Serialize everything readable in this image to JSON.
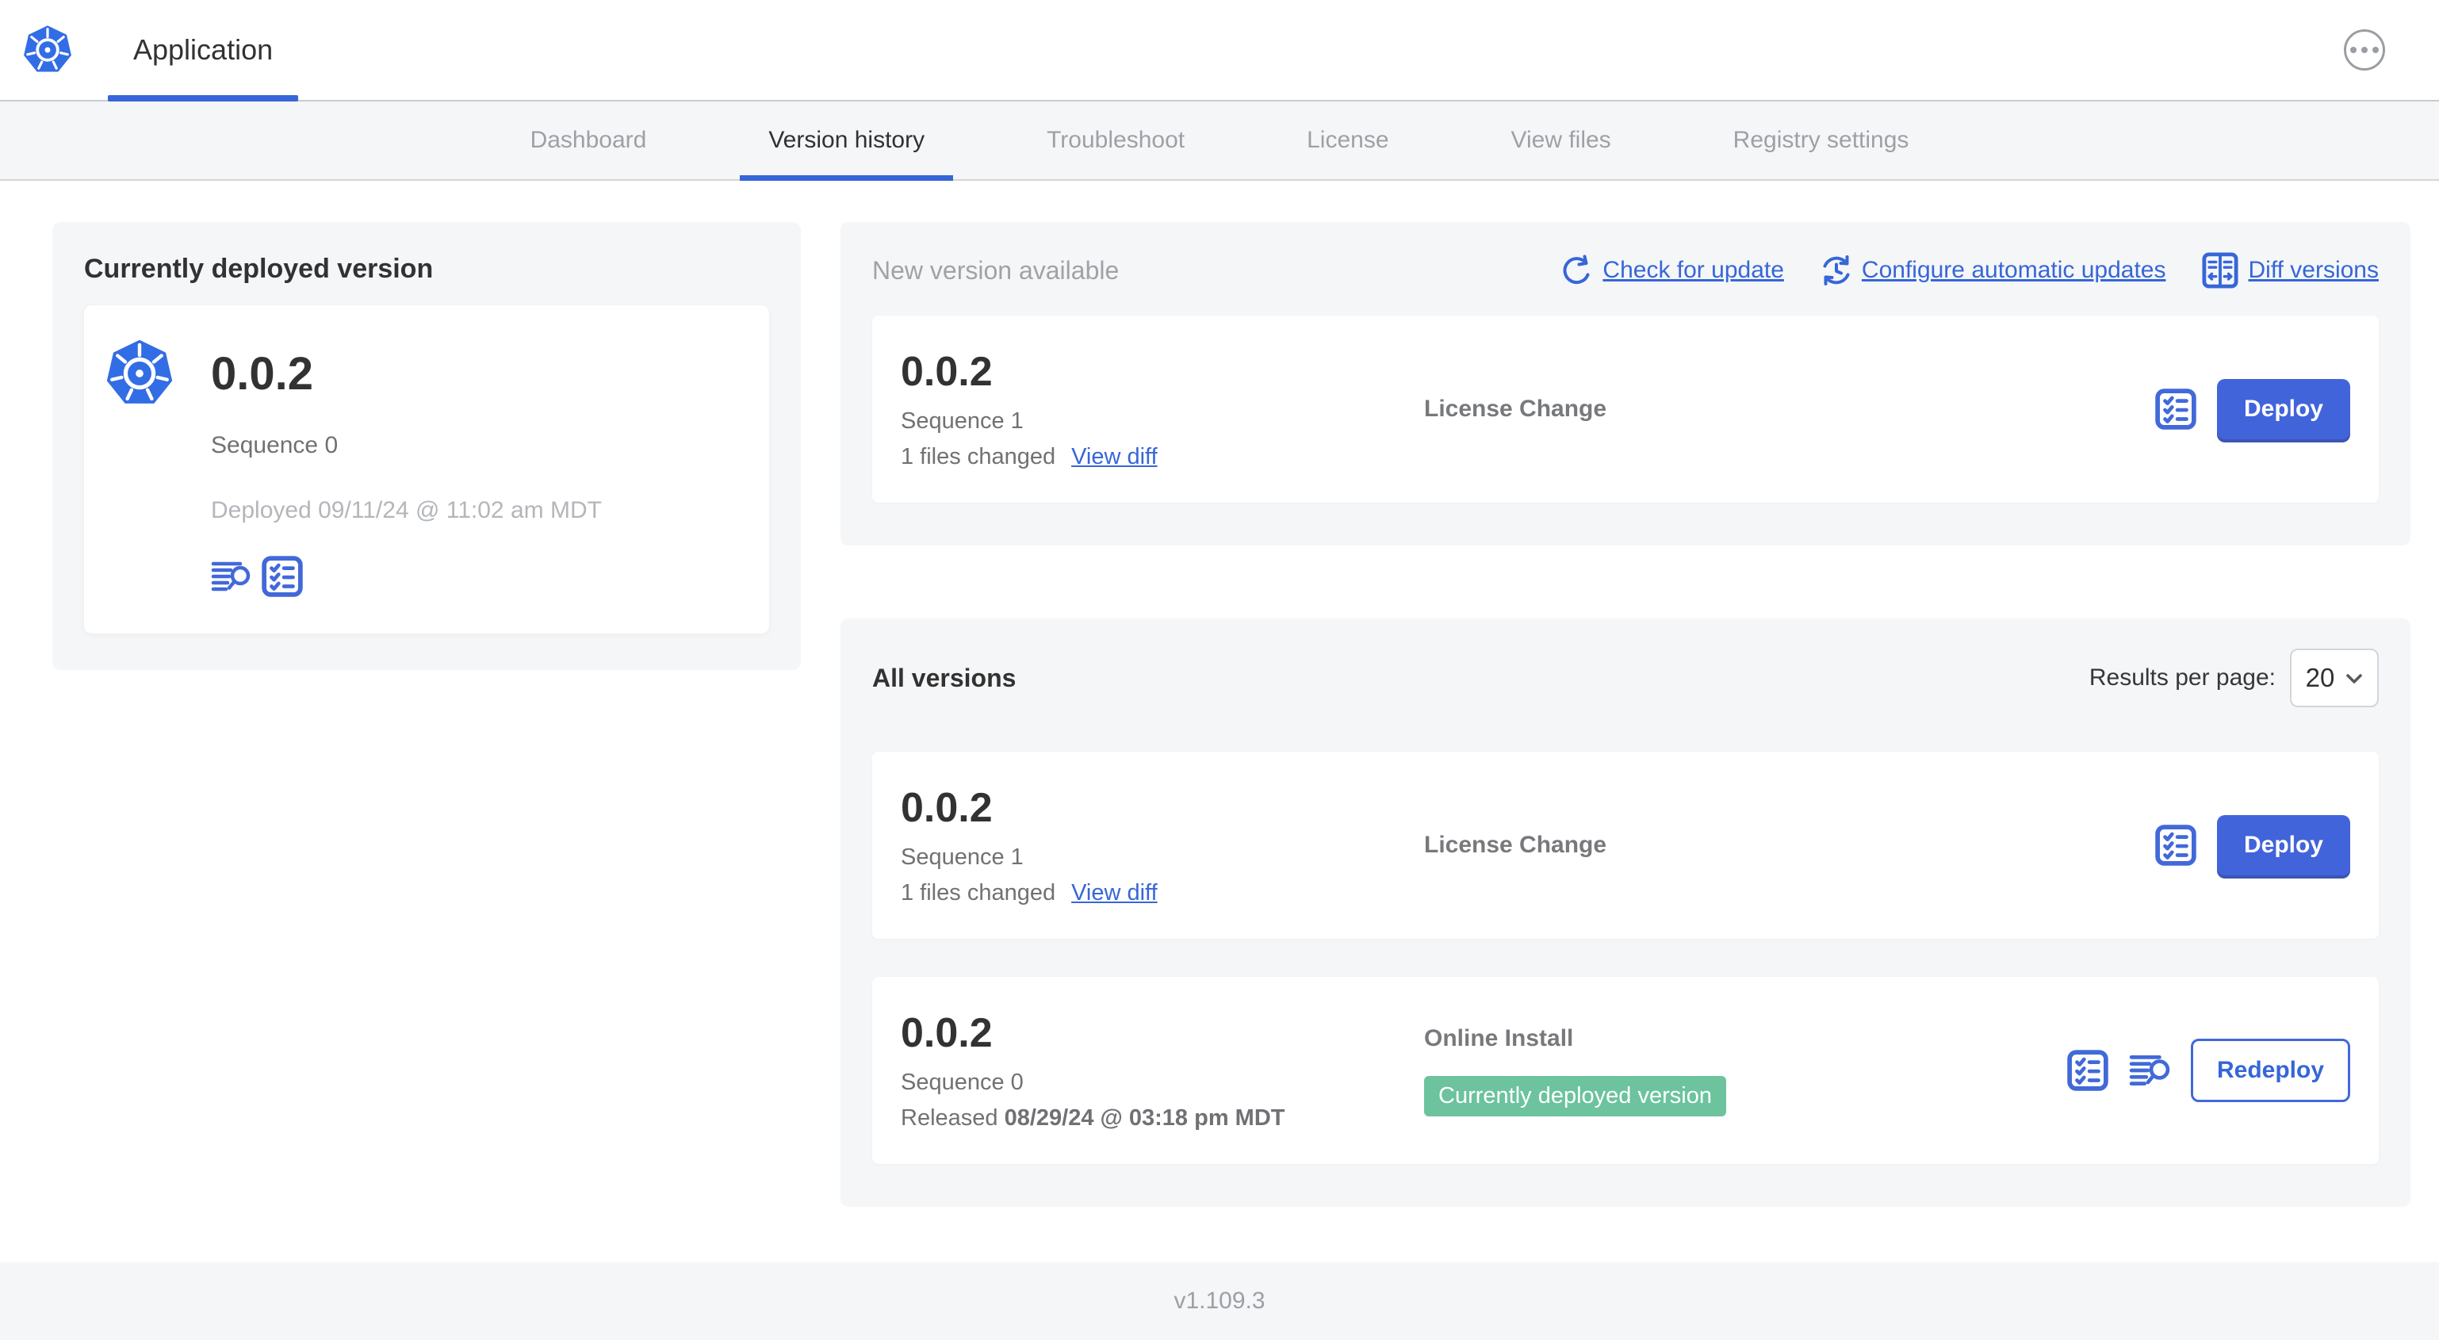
{
  "header": {
    "app_title": "Application"
  },
  "nav": {
    "tabs": [
      {
        "label": "Dashboard",
        "active": false
      },
      {
        "label": "Version history",
        "active": true
      },
      {
        "label": "Troubleshoot",
        "active": false
      },
      {
        "label": "License",
        "active": false
      },
      {
        "label": "View files",
        "active": false
      },
      {
        "label": "Registry settings",
        "active": false
      }
    ]
  },
  "current": {
    "title": "Currently deployed version",
    "version": "0.0.2",
    "sequence": "Sequence 0",
    "deployed": "Deployed 09/11/24 @ 11:02 am MDT"
  },
  "new_version": {
    "title": "New version available",
    "actions": {
      "check": {
        "label": "Check for update"
      },
      "configure": {
        "label": "Configure automatic updates"
      },
      "diff": {
        "label": "Diff versions"
      }
    },
    "card": {
      "version": "0.0.2",
      "sequence": "Sequence 1",
      "files_changed": "1 files changed",
      "view_diff": "View diff",
      "source": "License Change",
      "deploy_label": "Deploy"
    }
  },
  "all_versions": {
    "title": "All versions",
    "results_label": "Results per page:",
    "results_value": "20",
    "rows": [
      {
        "version": "0.0.2",
        "sequence": "Sequence 1",
        "files_changed": "1 files changed",
        "view_diff": "View diff",
        "source": "License Change",
        "action_label": "Deploy"
      },
      {
        "version": "0.0.2",
        "sequence": "Sequence 0",
        "released_label": "Released",
        "released_date": "08/29/24 @ 03:18 pm MDT",
        "source": "Online Install",
        "badge": "Currently deployed version",
        "action_label": "Redeploy"
      }
    ]
  },
  "footer": {
    "version": "v1.109.3"
  },
  "colors": {
    "accent_blue": "#3666d8",
    "button_blue": "#4264db",
    "icon_blue": "#4169d9",
    "kubernetes_blue": "#326de5",
    "badge_green": "#6cc39e",
    "panel_gray": "#f5f6f8",
    "text_dark": "#323232",
    "text_gray": "#717174",
    "text_light": "#b3b6ba"
  }
}
